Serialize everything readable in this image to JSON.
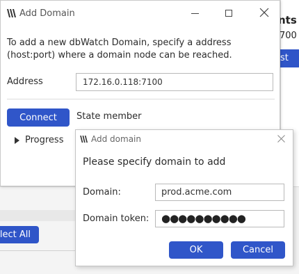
{
  "background": {
    "header_partial": "nts",
    "value_partial": "700",
    "test_button_partial": "st",
    "select_all_partial": "lect All"
  },
  "main_window": {
    "title": "Add Domain",
    "logo_icon": "dbwatch-logo-icon",
    "instruction": "To add a new dbWatch Domain, specify a address (host:port) where a domain node can be reached.",
    "address_label": "Address",
    "address_value": "172.16.0.118:7100",
    "connect_label": "Connect",
    "state_text": "State member",
    "progress_label": "Progress"
  },
  "dialog": {
    "title": "Add domain",
    "heading": "Please specify domain to add",
    "domain_label": "Domain:",
    "domain_value": "prod.acme.com",
    "token_label": "Domain token:",
    "token_mask": "●●●●●●●●●●",
    "ok_label": "OK",
    "cancel_label": "Cancel"
  },
  "colors": {
    "accent": "#3056c9"
  }
}
